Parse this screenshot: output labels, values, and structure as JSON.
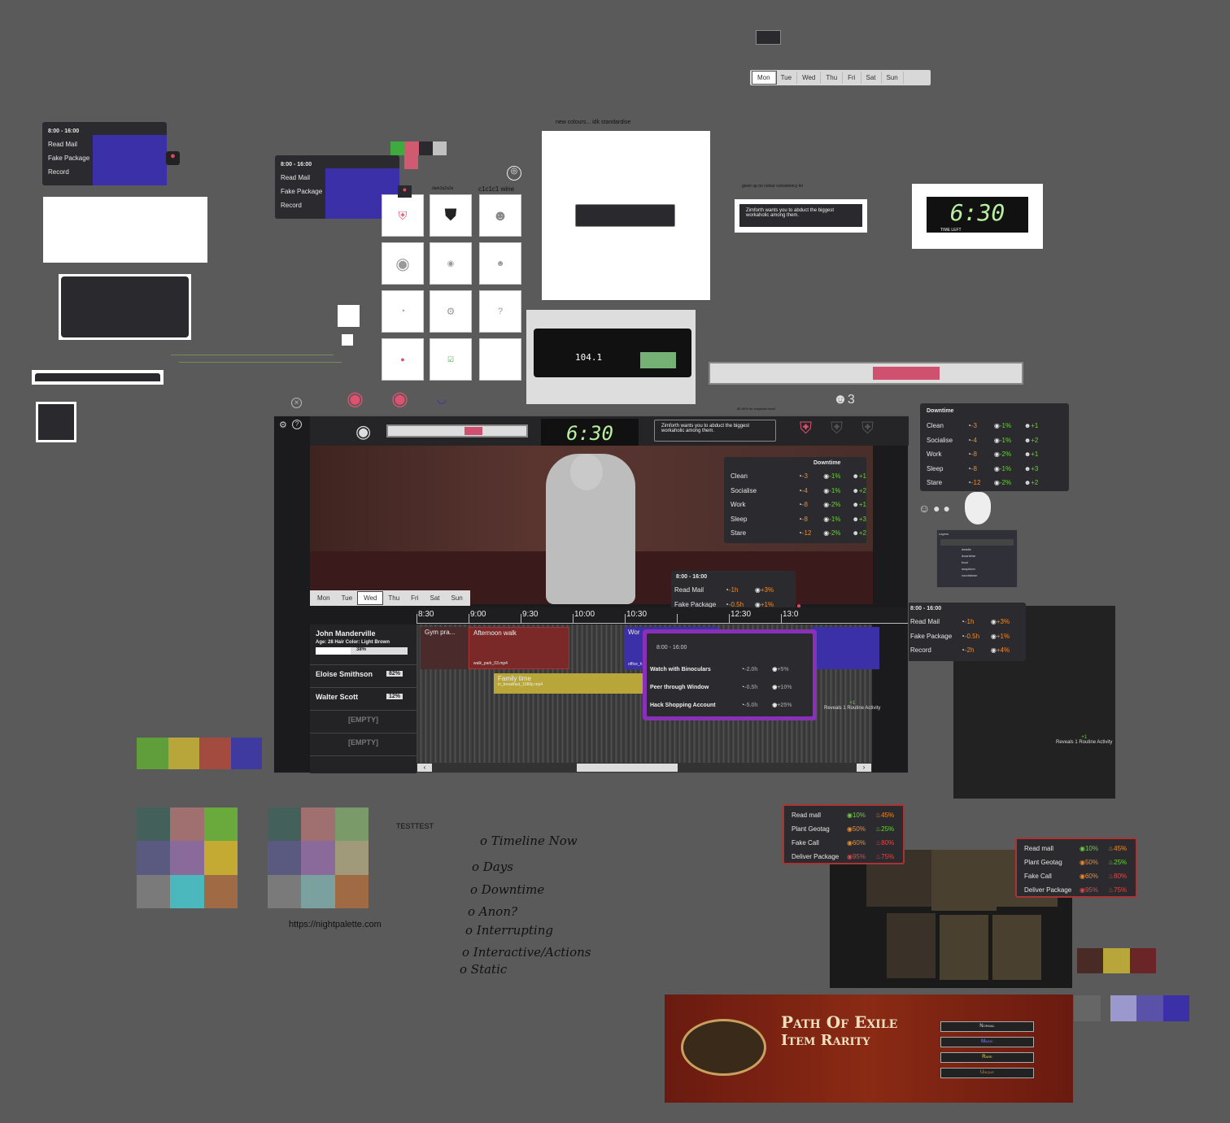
{
  "top_days": [
    "Mon",
    "Tue",
    "Wed",
    "Thu",
    "Fri",
    "Sat",
    "Sun"
  ],
  "schedule": {
    "time": "8:00 - 16:00",
    "items": [
      "Read Mail",
      "Fake Package",
      "Record"
    ]
  },
  "notes": {
    "new_colours": "new colours... idk standardise",
    "given_up": "given up on colour consistency lol",
    "dark_label": "dark2a2a2e",
    "wine_label": "c1c1c1 wine",
    "suspicion": "80-90% for suspicion level",
    "testtest": "TESTTEST",
    "url": "https://nightpalette.com"
  },
  "clock": {
    "time": "6:30",
    "label": "TIME LEFT"
  },
  "goal_text": "Zimforth wants you to abduct the biggest workaholic among them.",
  "mask_count": "3",
  "downtime": {
    "title": "Downtime",
    "rows": [
      {
        "name": "Clean",
        "time": "-3",
        "lock": "-1%",
        "mask": "+1"
      },
      {
        "name": "Socialise",
        "time": "-4",
        "lock": "-1%",
        "mask": "+2"
      },
      {
        "name": "Work",
        "time": "-8",
        "lock": "-2%",
        "mask": "+1"
      },
      {
        "name": "Sleep",
        "time": "-8",
        "lock": "-1%",
        "mask": "+3"
      },
      {
        "name": "Stare",
        "time": "-12",
        "lock": "-2%",
        "mask": "+2"
      }
    ]
  },
  "schedule_detail": {
    "time": "8:00 - 16:00",
    "rows": [
      {
        "name": "Read Mail",
        "time": "-1h",
        "pct": "+3%"
      },
      {
        "name": "Fake Package",
        "time": "-0.5h",
        "pct": "+1%"
      },
      {
        "name": "Record",
        "time": "-2h",
        "pct": "+4%"
      }
    ]
  },
  "timeline": {
    "days": [
      "Mon",
      "Tue",
      "Wed",
      "Thu",
      "Fri",
      "Sat",
      "Sun"
    ],
    "hours": [
      "8:30",
      "9:00",
      "9:30",
      "10:00",
      "10:30",
      "",
      "12:30",
      "13:0"
    ],
    "people": [
      {
        "name": "John Manderville",
        "age": "Age: 28",
        "hair": "Hair Color: Light Brown",
        "pct": "38%"
      },
      {
        "name": "Eloise Smithson",
        "pct": "82%"
      },
      {
        "name": "Walter Scott",
        "pct": "12%"
      },
      {
        "name": "[EMPTY]"
      },
      {
        "name": "[EMPTY]"
      }
    ],
    "blocks": {
      "gym": "Gym pra...",
      "walk": "Afternoon walk",
      "walk_file": "walk_park_03.mp4",
      "family": "Family time",
      "family_file": "in_breakfast_1080p.mp4",
      "work": "Wor",
      "work_file": "office_h"
    },
    "popup": {
      "time": "8:00 - 16:00",
      "rows": [
        {
          "name": "Watch with Binoculars",
          "time": "-2.0h",
          "pct": "+5%"
        },
        {
          "name": "Peer through Window",
          "time": "-0.5h",
          "pct": "+10%"
        },
        {
          "name": "Hack Shopping Account",
          "time": "-5.0h",
          "pct": "+25%"
        }
      ],
      "alt_time": "-2h",
      "alt_pct": "+5%"
    },
    "reveal": "Reveals 1 Routine Activity",
    "reveal_val": "+1"
  },
  "rarity": {
    "rows": [
      {
        "name": "Read mall",
        "eye": "10%",
        "fire": "45%"
      },
      {
        "name": "Plant Geotag",
        "eye": "50%",
        "fire": "25%"
      },
      {
        "name": "Fake Call",
        "eye": "60%",
        "fire": "80%"
      },
      {
        "name": "Deliver Package",
        "eye": "95%",
        "fire": "75%"
      }
    ]
  },
  "poe": {
    "title1": "Path Of Exile",
    "title2": "Item Rarity",
    "tiers": [
      "Normal",
      "Magic",
      "Rare",
      "Unique"
    ]
  },
  "todo": [
    "Timeline Now",
    "Days",
    "Downtime",
    "Anon?",
    "Interrupting",
    "Interactive/Actions",
    "Static"
  ],
  "layers": {
    "title": "Layers",
    "items": [
      "details",
      "downtime",
      "food",
      "suspicion",
      "countdown"
    ]
  },
  "colors": {
    "green": "#5f9e3a",
    "mustard": "#b8a63a",
    "brick": "#a34b3f",
    "indigo": "#3f3aa0"
  }
}
